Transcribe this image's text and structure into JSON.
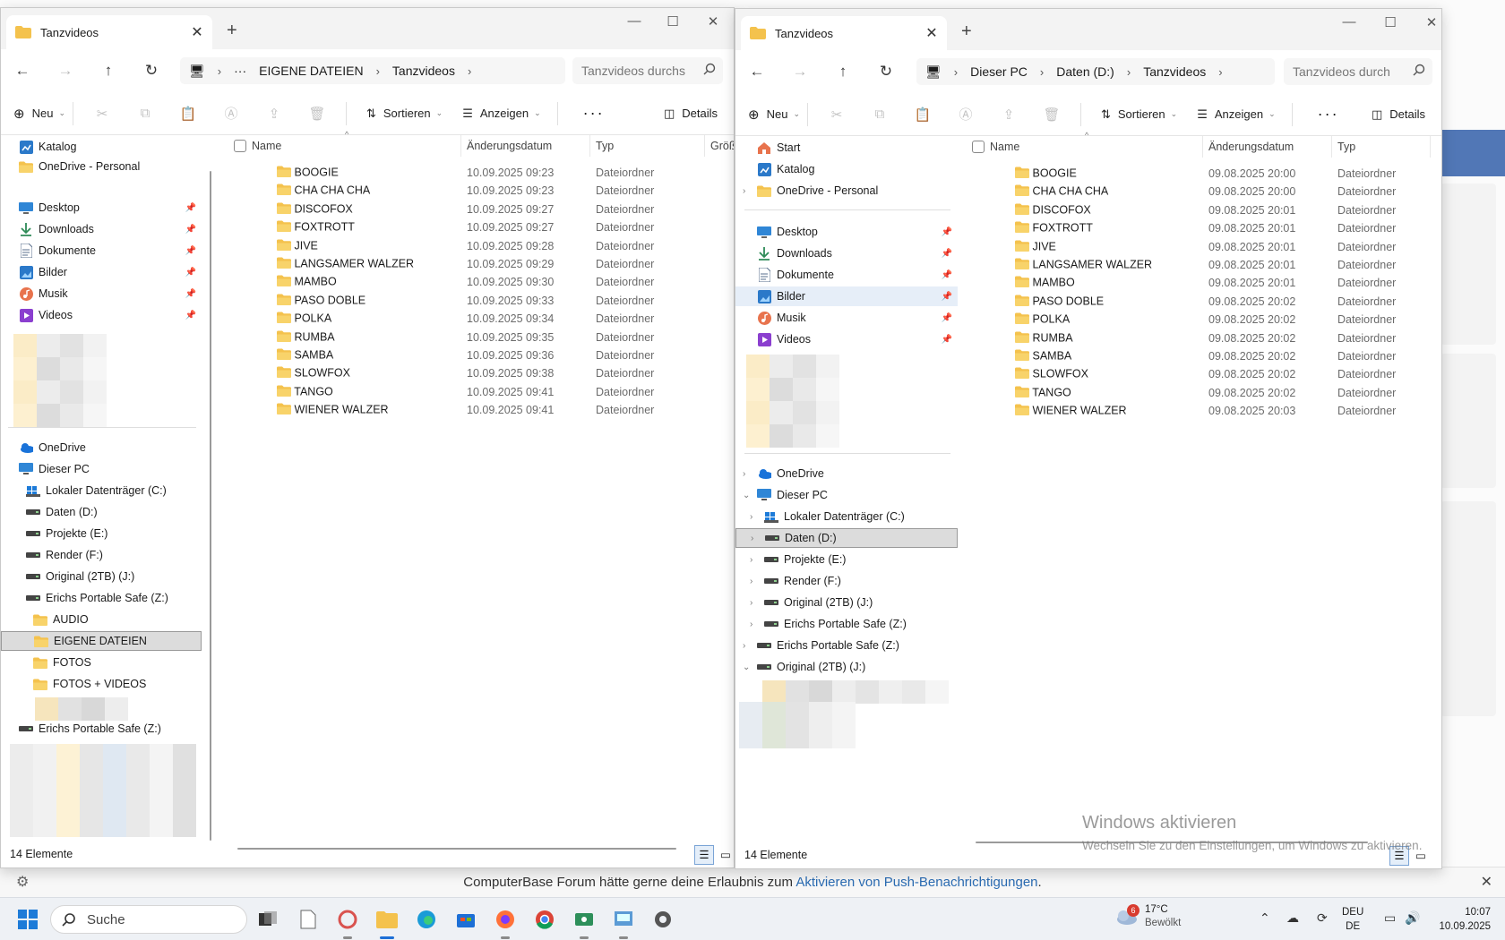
{
  "background_banner": {
    "text": "ComputerBase Forum hätte gerne deine Erlaubnis zum",
    "link": "Aktivieren von Push-Benachrichtigungen",
    "end": "."
  },
  "watermark": {
    "title": "Windows aktivieren",
    "subtitle": "Wechseln Sie zu den Einstellungen, um Windows zu aktivieren."
  },
  "colors": {
    "folder": "#f4c24d",
    "accent": "#1d6fd6",
    "selection": "#dcdcdc"
  },
  "left": {
    "tab_title": "Tanzvideos",
    "breadcrumb": [
      "EIGENE DATEIEN",
      "Tanzvideos"
    ],
    "breadcrumb_more": "···",
    "search_placeholder": "Tanzvideos durchs",
    "toolbar": {
      "new": "Neu",
      "sort": "Sortieren",
      "view": "Anzeigen",
      "details": "Details"
    },
    "columns": {
      "name": "Name",
      "date": "Änderungsdatum",
      "type": "Typ",
      "size": "Größe"
    },
    "nav_top": [
      "Katalog",
      "OneDrive - Personal"
    ],
    "nav_quick": [
      "Desktop",
      "Downloads",
      "Dokumente",
      "Bilder",
      "Musik",
      "Videos"
    ],
    "nav_tree": [
      {
        "label": "OneDrive",
        "icon": "cloud-icon",
        "indent": 0
      },
      {
        "label": "Dieser PC",
        "icon": "computer-icon",
        "indent": 0
      },
      {
        "label": "Lokaler Datenträger (C:)",
        "icon": "windows-drive-icon",
        "indent": 1
      },
      {
        "label": "Daten (D:)",
        "icon": "drive-icon",
        "indent": 1
      },
      {
        "label": "Projekte (E:)",
        "icon": "drive-icon",
        "indent": 1
      },
      {
        "label": "Render (F:)",
        "icon": "drive-icon",
        "indent": 1
      },
      {
        "label": "Original (2TB) (J:)",
        "icon": "drive-icon",
        "indent": 1
      },
      {
        "label": "Erichs Portable Safe (Z:)",
        "icon": "drive-icon",
        "indent": 1
      },
      {
        "label": "AUDIO",
        "icon": "folder-icon",
        "indent": 2
      },
      {
        "label": "EIGENE DATEIEN",
        "icon": "folder-icon",
        "indent": 2,
        "selected": true
      },
      {
        "label": "FOTOS",
        "icon": "folder-icon",
        "indent": 2
      },
      {
        "label": "FOTOS + VIDEOS",
        "icon": "folder-icon",
        "indent": 2
      }
    ],
    "nav_bottom": "Erichs Portable Safe (Z:)",
    "files": [
      {
        "name": "BOOGIE",
        "date": "10.09.2025 09:23",
        "type": "Dateiordner"
      },
      {
        "name": "CHA CHA CHA",
        "date": "10.09.2025 09:23",
        "type": "Dateiordner"
      },
      {
        "name": "DISCOFOX",
        "date": "10.09.2025 09:27",
        "type": "Dateiordner"
      },
      {
        "name": "FOXTROTT",
        "date": "10.09.2025 09:27",
        "type": "Dateiordner"
      },
      {
        "name": "JIVE",
        "date": "10.09.2025 09:28",
        "type": "Dateiordner"
      },
      {
        "name": "LANGSAMER WALZER",
        "date": "10.09.2025 09:29",
        "type": "Dateiordner"
      },
      {
        "name": "MAMBO",
        "date": "10.09.2025 09:30",
        "type": "Dateiordner"
      },
      {
        "name": "PASO DOBLE",
        "date": "10.09.2025 09:33",
        "type": "Dateiordner"
      },
      {
        "name": "POLKA",
        "date": "10.09.2025 09:34",
        "type": "Dateiordner"
      },
      {
        "name": "RUMBA",
        "date": "10.09.2025 09:35",
        "type": "Dateiordner"
      },
      {
        "name": "SAMBA",
        "date": "10.09.2025 09:36",
        "type": "Dateiordner"
      },
      {
        "name": "SLOWFOX",
        "date": "10.09.2025 09:38",
        "type": "Dateiordner"
      },
      {
        "name": "TANGO",
        "date": "10.09.2025 09:41",
        "type": "Dateiordner"
      },
      {
        "name": "WIENER WALZER",
        "date": "10.09.2025 09:41",
        "type": "Dateiordner"
      }
    ],
    "status": "14 Elemente"
  },
  "right": {
    "tab_title": "Tanzvideos",
    "breadcrumb": [
      "Dieser PC",
      "Daten (D:)",
      "Tanzvideos"
    ],
    "search_placeholder": "Tanzvideos durch",
    "toolbar": {
      "new": "Neu",
      "sort": "Sortieren",
      "view": "Anzeigen",
      "details": "Details"
    },
    "columns": {
      "name": "Name",
      "date": "Änderungsdatum",
      "type": "Typ"
    },
    "nav_top": [
      "Start",
      "Katalog",
      "OneDrive - Personal"
    ],
    "nav_quick": [
      "Desktop",
      "Downloads",
      "Dokumente",
      "Bilder",
      "Musik",
      "Videos"
    ],
    "nav_tree": [
      {
        "label": "OneDrive",
        "icon": "cloud-icon",
        "indent": 0
      },
      {
        "label": "Dieser PC",
        "icon": "computer-icon",
        "indent": 0
      },
      {
        "label": "Lokaler Datenträger (C:)",
        "icon": "windows-drive-icon",
        "indent": 1
      },
      {
        "label": "Daten (D:)",
        "icon": "drive-icon",
        "indent": 1,
        "selected": true
      },
      {
        "label": "Projekte (E:)",
        "icon": "drive-icon",
        "indent": 1
      },
      {
        "label": "Render (F:)",
        "icon": "drive-icon",
        "indent": 1
      },
      {
        "label": "Original (2TB) (J:)",
        "icon": "drive-icon",
        "indent": 1
      },
      {
        "label": "Erichs Portable Safe (Z:)",
        "icon": "drive-icon",
        "indent": 1
      },
      {
        "label": "Erichs Portable Safe (Z:)",
        "icon": "drive-icon",
        "indent": 0
      },
      {
        "label": "Original (2TB) (J:)",
        "icon": "drive-icon",
        "indent": 0
      }
    ],
    "files": [
      {
        "name": "BOOGIE",
        "date": "09.08.2025 20:00",
        "type": "Dateiordner"
      },
      {
        "name": "CHA CHA CHA",
        "date": "09.08.2025 20:00",
        "type": "Dateiordner"
      },
      {
        "name": "DISCOFOX",
        "date": "09.08.2025 20:01",
        "type": "Dateiordner"
      },
      {
        "name": "FOXTROTT",
        "date": "09.08.2025 20:01",
        "type": "Dateiordner"
      },
      {
        "name": "JIVE",
        "date": "09.08.2025 20:01",
        "type": "Dateiordner"
      },
      {
        "name": "LANGSAMER WALZER",
        "date": "09.08.2025 20:01",
        "type": "Dateiordner"
      },
      {
        "name": "MAMBO",
        "date": "09.08.2025 20:01",
        "type": "Dateiordner"
      },
      {
        "name": "PASO DOBLE",
        "date": "09.08.2025 20:02",
        "type": "Dateiordner"
      },
      {
        "name": "POLKA",
        "date": "09.08.2025 20:02",
        "type": "Dateiordner"
      },
      {
        "name": "RUMBA",
        "date": "09.08.2025 20:02",
        "type": "Dateiordner"
      },
      {
        "name": "SAMBA",
        "date": "09.08.2025 20:02",
        "type": "Dateiordner"
      },
      {
        "name": "SLOWFOX",
        "date": "09.08.2025 20:02",
        "type": "Dateiordner"
      },
      {
        "name": "TANGO",
        "date": "09.08.2025 20:02",
        "type": "Dateiordner"
      },
      {
        "name": "WIENER WALZER",
        "date": "09.08.2025 20:03",
        "type": "Dateiordner"
      }
    ],
    "status": "14 Elemente"
  },
  "taskbar": {
    "search_placeholder": "Suche",
    "weather_temp": "17°C",
    "weather_desc": "Bewölkt",
    "weather_badge": "6",
    "lang_1": "DEU",
    "lang_2": "DE",
    "time": "10:07",
    "date": "10.09.2025"
  }
}
